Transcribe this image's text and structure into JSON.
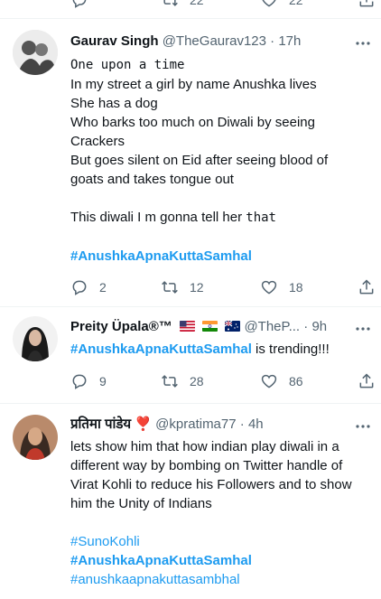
{
  "top_partial": {
    "reply_count": "22",
    "retweet_count": "22"
  },
  "tweets": [
    {
      "display_name": "Gaurav Singh",
      "handle": "@TheGaurav123",
      "separator": "·",
      "time": "17h",
      "text_lines": [
        "One upon a time",
        "In my street a girl by name Anushka lives",
        "She has a dog",
        "Who barks too much on Diwali by seeing",
        "Crackers",
        "But goes silent on Eid after seeing blood of",
        "goats and takes tongue out",
        "This diwali I m gonna tell her ",
        "that"
      ],
      "hashtag": "#AnushkaApnaKuttaSamhal",
      "replies": "2",
      "retweets": "12",
      "likes": "18"
    },
    {
      "display_name": "Preity Üpala®™",
      "handle": "@TheP...",
      "separator": "·",
      "time": "9h",
      "hashtag": "#AnushkaApnaKuttaSamhal",
      "text_after": " is trending!!!",
      "replies": "9",
      "retweets": "28",
      "likes": "86"
    },
    {
      "display_name": "प्रतिमा पांडेय",
      "emoji": "❣️",
      "handle": "@kpratima77",
      "separator": "·",
      "time": "4h",
      "text_lines": [
        "lets show him that how indian play diwali in a",
        "different way by bombing on Twitter handle of",
        "Virat Kohli to reduce his Followers and to show",
        "him the Unity of Indians"
      ],
      "hashtags": [
        "#SunoKohli",
        "#AnushkaApnaKuttaSamhal",
        "#anushkaapnakuttasambhal"
      ]
    }
  ],
  "colors": {
    "link": "#1d9bf0",
    "muted": "#536471",
    "text": "#0f1419",
    "divider": "#eff3f4"
  }
}
